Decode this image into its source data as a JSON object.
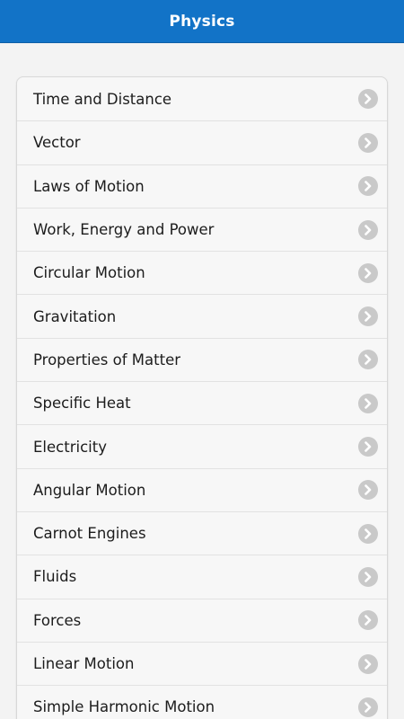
{
  "header": {
    "title": "Physics"
  },
  "colors": {
    "header_bar": "#1273c7",
    "page_background": "#f3f3f3",
    "list_background": "#f7f7f7",
    "chevron_background": "#c9c9c9",
    "chevron_glyph": "#ffffff"
  },
  "topics": {
    "items": [
      {
        "label": "Time and Distance",
        "icon": "chevron-right-icon"
      },
      {
        "label": "Vector",
        "icon": "chevron-right-icon"
      },
      {
        "label": "Laws of Motion",
        "icon": "chevron-right-icon"
      },
      {
        "label": "Work, Energy and Power",
        "icon": "chevron-right-icon"
      },
      {
        "label": "Circular Motion",
        "icon": "chevron-right-icon"
      },
      {
        "label": "Gravitation",
        "icon": "chevron-right-icon"
      },
      {
        "label": "Properties of Matter",
        "icon": "chevron-right-icon"
      },
      {
        "label": "Specific Heat",
        "icon": "chevron-right-icon"
      },
      {
        "label": "Electricity",
        "icon": "chevron-right-icon"
      },
      {
        "label": "Angular Motion",
        "icon": "chevron-right-icon"
      },
      {
        "label": "Carnot Engines",
        "icon": "chevron-right-icon"
      },
      {
        "label": "Fluids",
        "icon": "chevron-right-icon"
      },
      {
        "label": "Forces",
        "icon": "chevron-right-icon"
      },
      {
        "label": "Linear Motion",
        "icon": "chevron-right-icon"
      },
      {
        "label": "Simple Harmonic Motion",
        "icon": "chevron-right-icon"
      }
    ]
  }
}
